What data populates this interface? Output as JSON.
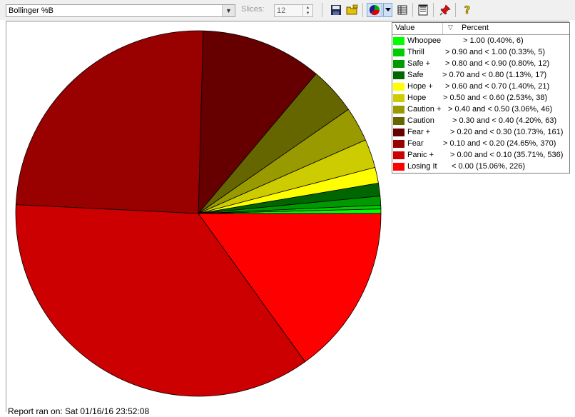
{
  "toolbar": {
    "indicator_select": "Bollinger %B",
    "slices_label": "Slices:",
    "slices_value": "12",
    "icons": [
      "save-icon",
      "open-folder-icon",
      "pie-chart-icon",
      "dropdown-arrow-icon",
      "table-icon",
      "report-icon",
      "pin-icon",
      "help-icon"
    ]
  },
  "legend": {
    "header_value": "Value",
    "header_percent": "Percent"
  },
  "chart_data": {
    "type": "pie",
    "start_angle_deg": 0,
    "direction": "counterclockwise",
    "slices": [
      {
        "name": "Whoopee",
        "label": "> 1.00 (0.40%, 6)",
        "percent": 0.4,
        "count": 6,
        "color": "#00ff00"
      },
      {
        "name": "Thrill",
        "label": "> 0.90 and < 1.00 (0.33%, 5)",
        "percent": 0.33,
        "count": 5,
        "color": "#00cc00"
      },
      {
        "name": "Safe +",
        "label": "> 0.80 and < 0.90 (0.80%, 12)",
        "percent": 0.8,
        "count": 12,
        "color": "#009900"
      },
      {
        "name": "Safe",
        "label": "> 0.70 and < 0.80 (1.13%, 17)",
        "percent": 1.13,
        "count": 17,
        "color": "#006600"
      },
      {
        "name": "Hope +",
        "label": "> 0.60 and < 0.70 (1.40%, 21)",
        "percent": 1.4,
        "count": 21,
        "color": "#ffff00"
      },
      {
        "name": "Hope",
        "label": "> 0.50 and < 0.60 (2.53%, 38)",
        "percent": 2.53,
        "count": 38,
        "color": "#cccc00"
      },
      {
        "name": "Caution +",
        "label": "> 0.40 and < 0.50 (3.06%, 46)",
        "percent": 3.06,
        "count": 46,
        "color": "#999900"
      },
      {
        "name": "Caution",
        "label": "> 0.30 and < 0.40 (4.20%, 63)",
        "percent": 4.2,
        "count": 63,
        "color": "#666600"
      },
      {
        "name": "Fear +",
        "label": "> 0.20 and < 0.30 (10.73%, 161)",
        "percent": 10.73,
        "count": 161,
        "color": "#660000"
      },
      {
        "name": "Fear",
        "label": "> 0.10 and < 0.20 (24.65%, 370)",
        "percent": 24.65,
        "count": 370,
        "color": "#990000"
      },
      {
        "name": "Panic +",
        "label": "> 0.00 and < 0.10 (35.71%, 536)",
        "percent": 35.71,
        "count": 536,
        "color": "#cc0000"
      },
      {
        "name": "Losing It",
        "label": "< 0.00 (15.06%, 226)",
        "percent": 15.06,
        "count": 226,
        "color": "#ff0000"
      }
    ]
  },
  "footer": {
    "report_text": "Report ran on: Sat 01/16/16 23:52:08"
  }
}
